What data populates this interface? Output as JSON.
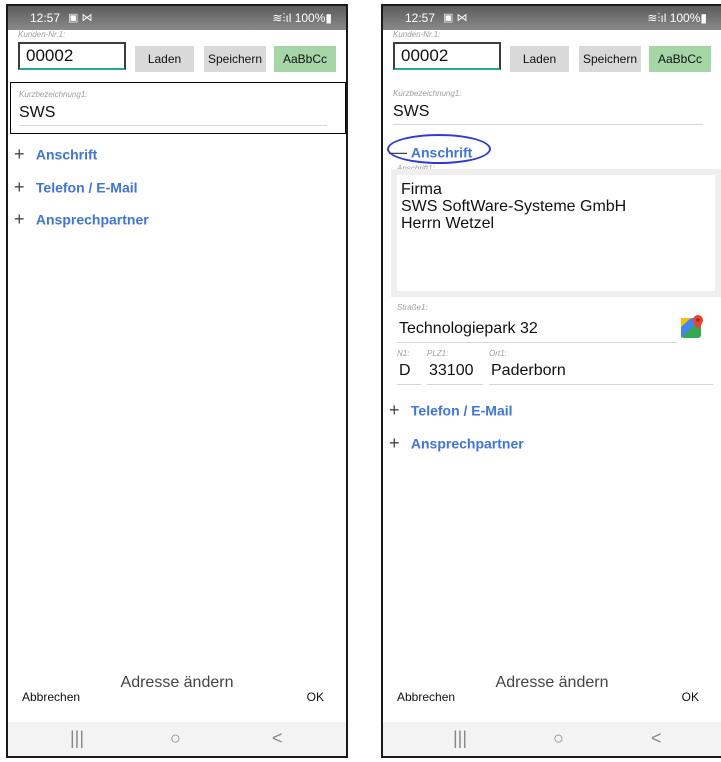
{
  "screens": [
    {
      "status": {
        "time": "12:57",
        "icons": "▣ ⋈",
        "signal": "≋⫶ıl 100%▮"
      },
      "kunden_nr": {
        "label": "Kunden-Nr.1:",
        "value": "00002"
      },
      "buttons": {
        "laden": "Laden",
        "speichern": "Speichern",
        "font": "AaBbCc"
      },
      "kurz": {
        "label": "Kurzbezeichnung1:",
        "value": "SWS"
      },
      "sections": [
        {
          "symbol": "+",
          "title": "Anschrift"
        },
        {
          "symbol": "+",
          "title": "Telefon / E-Mail"
        },
        {
          "symbol": "+",
          "title": "Ansprechpartner"
        }
      ],
      "bottom": {
        "cancel": "Abbrechen",
        "title": "Adresse ändern",
        "ok": "OK"
      },
      "nav": {
        "recent": "|||",
        "home": "○",
        "back": "<"
      }
    },
    {
      "status": {
        "time": "12:57",
        "icons": "▣ ⋈",
        "signal": "≋⫶ıl 100%▮"
      },
      "kunden_nr": {
        "label": "Kunden-Nr.1:",
        "value": "00002"
      },
      "buttons": {
        "laden": "Laden",
        "speichern": "Speichern",
        "font": "AaBbCc"
      },
      "kurz": {
        "label": "Kurzbezeichnung1:",
        "value": "SWS"
      },
      "sections": [
        {
          "symbol": "—",
          "title": "Anschrift"
        },
        {
          "symbol": "+",
          "title": "Telefon / E-Mail"
        },
        {
          "symbol": "+",
          "title": "Ansprechpartner"
        }
      ],
      "anschrift": {
        "label": "Anschrift1:",
        "lines": [
          "Firma",
          "SWS SoftWare-Systeme GmbH",
          "Herrn Wetzel"
        ]
      },
      "strasse": {
        "label": "Straße1:",
        "value": "Technologiepark 32"
      },
      "nation": {
        "label": "N1:",
        "value": "D"
      },
      "plz": {
        "label": "PLZ1:",
        "value": "33100"
      },
      "ort": {
        "label": "Ort1:",
        "value": "Paderborn"
      },
      "bottom": {
        "cancel": "Abbrechen",
        "title": "Adresse ändern",
        "ok": "OK"
      },
      "nav": {
        "recent": "|||",
        "home": "○",
        "back": "<"
      }
    }
  ]
}
